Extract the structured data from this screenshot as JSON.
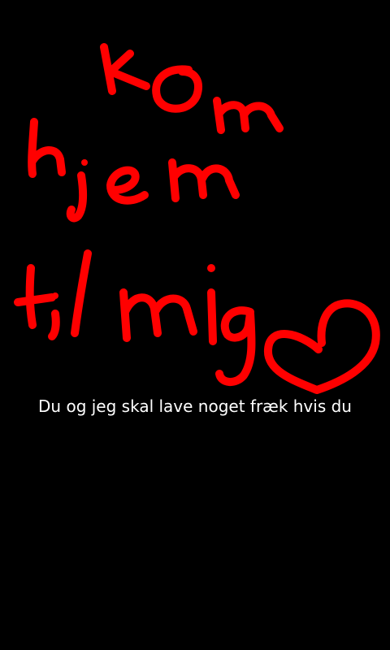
{
  "drawing": {
    "handwritten_text": "kom hjem til mig",
    "stroke_color": "#ff0000",
    "heart_icon": "heart-icon"
  },
  "caption": {
    "text": "Du og jeg skal lave noget fræk hvis du"
  },
  "colors": {
    "background": "#000000",
    "caption": "#ffffff"
  }
}
